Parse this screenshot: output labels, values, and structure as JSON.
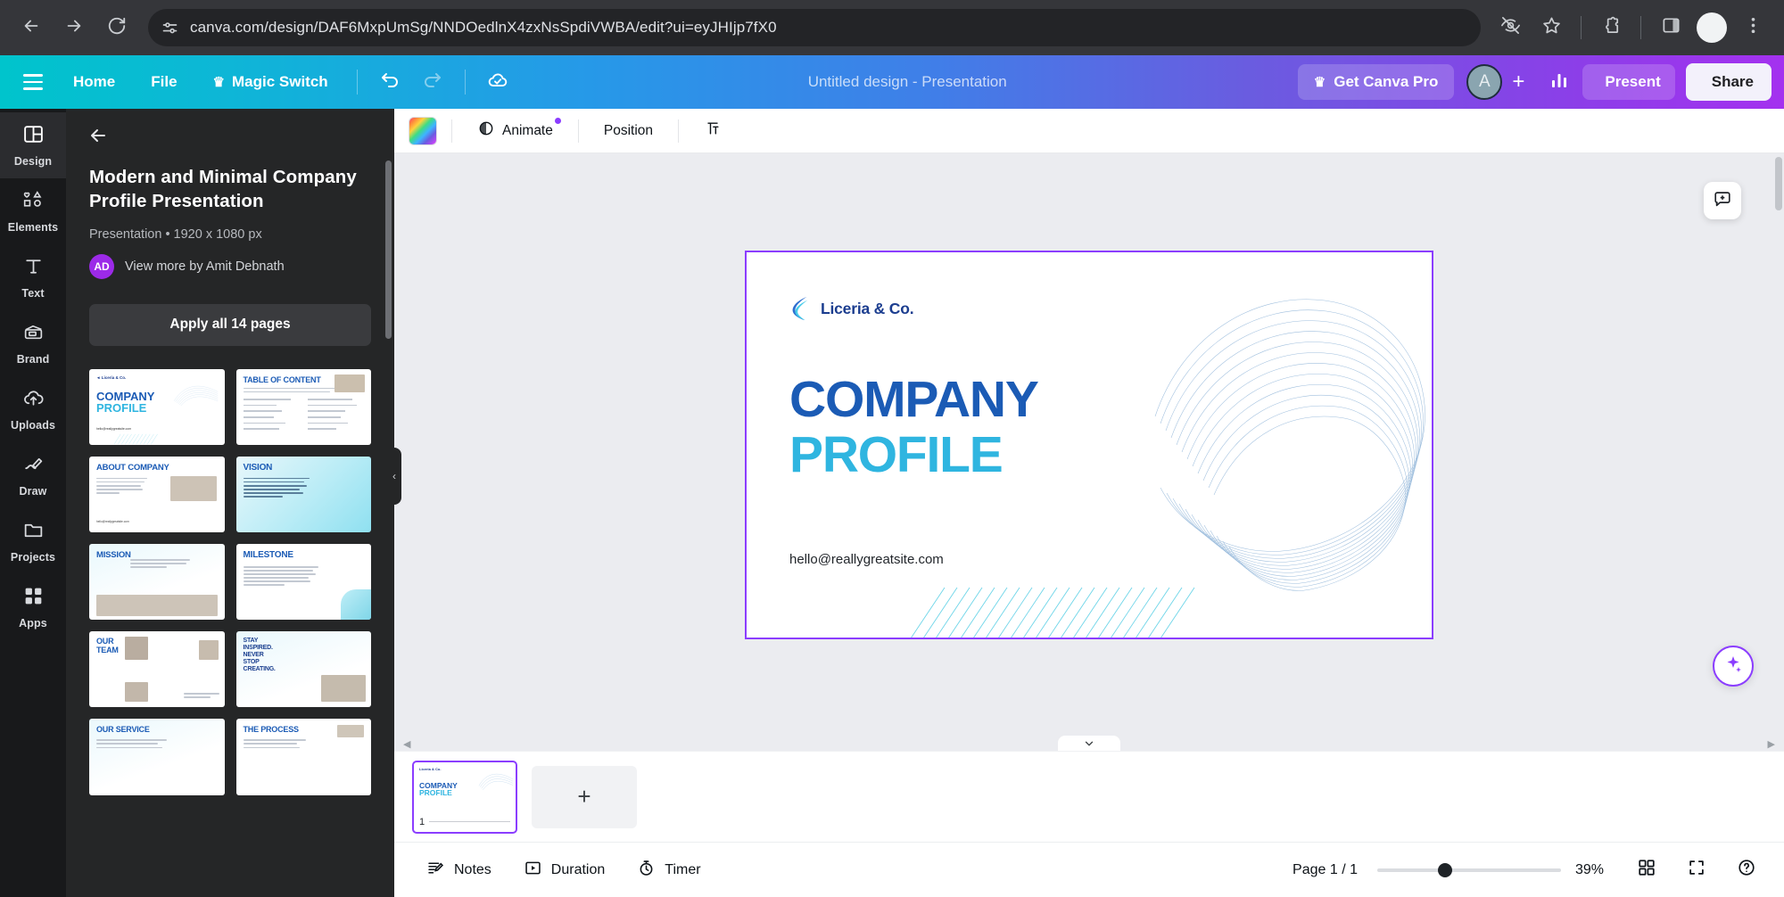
{
  "browser": {
    "url": "canva.com/design/DAF6MxpUmSg/NNDOedlnX4zxNsSpdiVWBA/edit?ui=eyJHIjp7fX0",
    "back_icon": "back-arrow-icon",
    "forward_icon": "forward-arrow-icon",
    "reload_icon": "reload-icon",
    "site_info_icon": "site-settings-icon",
    "tracking_icon": "eye-off-icon",
    "bookmark_icon": "star-icon",
    "extensions_icon": "extensions-puzzle-icon",
    "sidepanel_icon": "side-panel-icon",
    "profile_icon": "profile-avatar-icon",
    "menu_icon": "three-dot-menu-icon"
  },
  "topbar": {
    "menu_label": "menu",
    "home": "Home",
    "file": "File",
    "magic_switch": "Magic Switch",
    "crown": "♛",
    "undo_icon": "undo-icon",
    "redo_icon": "redo-icon",
    "cloud_icon": "cloud-saved-icon",
    "doc_title": "Untitled design - Presentation",
    "get_pro": "Get Canva Pro",
    "avatar_initial": "A",
    "add_collaborator": "+",
    "insights_icon": "insights-bar-chart-icon",
    "present": "Present",
    "share": "Share"
  },
  "rail": {
    "items": [
      {
        "label": "Design",
        "icon": "design-layout-icon",
        "active": true
      },
      {
        "label": "Elements",
        "icon": "elements-shapes-icon",
        "active": false
      },
      {
        "label": "Text",
        "icon": "text-t-icon",
        "active": false
      },
      {
        "label": "Brand",
        "icon": "brand-kit-icon",
        "active": false
      },
      {
        "label": "Uploads",
        "icon": "upload-cloud-icon",
        "active": false
      },
      {
        "label": "Draw",
        "icon": "draw-pen-icon",
        "active": false
      },
      {
        "label": "Projects",
        "icon": "projects-folder-icon",
        "active": false
      },
      {
        "label": "Apps",
        "icon": "apps-grid-icon",
        "active": false
      }
    ]
  },
  "panel": {
    "back_icon": "back-arrow-icon",
    "title": "Modern and Minimal Company Profile Presentation",
    "subtitle": "Presentation • 1920 x 1080 px",
    "author_badge": "AD",
    "author_line": "View more by Amit Debnath",
    "apply_button": "Apply all 14 pages",
    "thumbnails": [
      {
        "title": "COMPANY PROFILE",
        "kind": "cover"
      },
      {
        "title": "TABLE OF CONTENT",
        "kind": "toc"
      },
      {
        "title": "ABOUT COMPANY",
        "kind": "about"
      },
      {
        "title": "VISION",
        "kind": "vision"
      },
      {
        "title": "MISSION",
        "kind": "mission"
      },
      {
        "title": "MILESTONE",
        "kind": "milestone"
      },
      {
        "title": "OUR TEAM",
        "kind": "team"
      },
      {
        "title": "STAY INSPIRED. NEVER STOP CREATING.",
        "kind": "quote"
      },
      {
        "title": "OUR SERVICE",
        "kind": "service"
      },
      {
        "title": "THE PROCESS",
        "kind": "process"
      }
    ]
  },
  "toolbar": {
    "color_swatch": "color-swatch",
    "animate": "Animate",
    "position": "Position",
    "transparency_icon": "transparency-icon"
  },
  "slide": {
    "logo_text": "Liceria & Co.",
    "logo_icon": "liceria-swoosh-logo",
    "heading_line1": "COMPANY",
    "heading_line2": "PROFILE",
    "email": "hello@reallygreatsite.com",
    "comment_icon": "add-comment-icon",
    "ai_icon": "magic-ai-sparkle-icon",
    "colors": {
      "heading_dark": "#1b5bb5",
      "heading_light": "#2fb5e0",
      "selection": "#8b3dff"
    }
  },
  "pages": {
    "current_thumb_title_1": "COMPANY",
    "current_thumb_title_2": "PROFILE",
    "current_thumb_logo": "Liceria & Co.",
    "page_number": "1",
    "add_page": "+",
    "collapse_icon": "chevron-down-icon"
  },
  "footer": {
    "notes": "Notes",
    "notes_icon": "notes-icon",
    "duration": "Duration",
    "duration_icon": "duration-play-icon",
    "timer": "Timer",
    "timer_icon": "timer-stopwatch-icon",
    "page_indicator": "Page 1 / 1",
    "zoom_value": "39%",
    "grid_icon": "grid-view-icon",
    "fullscreen_icon": "fullscreen-expand-icon",
    "help_icon": "help-question-icon"
  }
}
